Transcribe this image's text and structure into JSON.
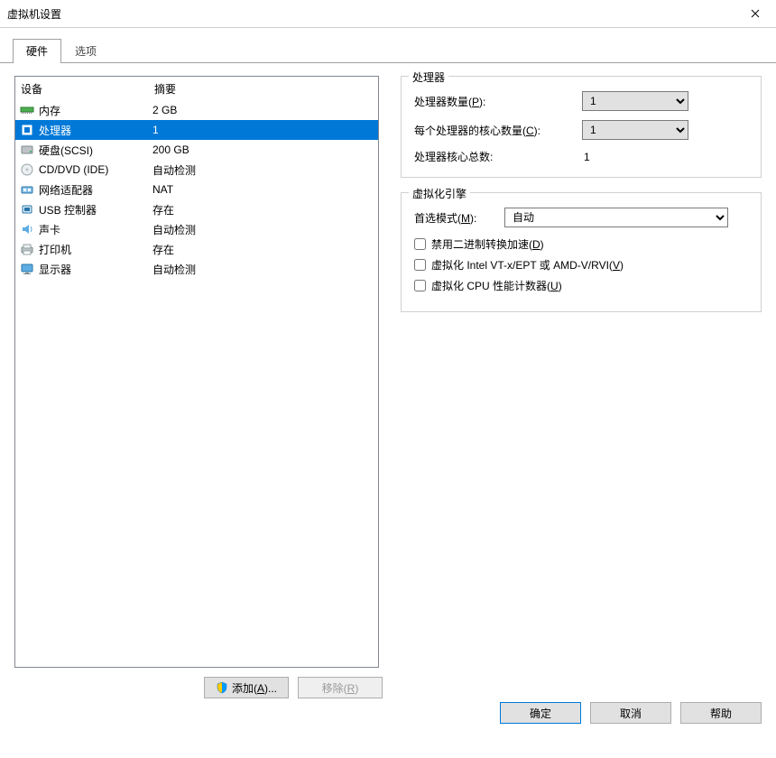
{
  "window": {
    "title": "虚拟机设置"
  },
  "tabs": {
    "hardware": "硬件",
    "options": "选项"
  },
  "hw_header": {
    "device": "设备",
    "summary": "摘要"
  },
  "hw": [
    {
      "icon": "memory",
      "name": "内存",
      "summary": "2 GB"
    },
    {
      "icon": "cpu",
      "name": "处理器",
      "summary": "1"
    },
    {
      "icon": "disk",
      "name": "硬盘(SCSI)",
      "summary": "200 GB"
    },
    {
      "icon": "cd",
      "name": "CD/DVD (IDE)",
      "summary": "自动检测"
    },
    {
      "icon": "net",
      "name": "网络适配器",
      "summary": "NAT"
    },
    {
      "icon": "usb",
      "name": "USB 控制器",
      "summary": "存在"
    },
    {
      "icon": "sound",
      "name": "声卡",
      "summary": "自动检测"
    },
    {
      "icon": "printer",
      "name": "打印机",
      "summary": "存在"
    },
    {
      "icon": "display",
      "name": "显示器",
      "summary": "自动检测"
    }
  ],
  "selected_hw_index": 1,
  "proc_group": {
    "legend": "处理器",
    "proc_count_label_pre": "处理器数量(",
    "proc_count_hot": "P",
    "proc_count_label_post": "):",
    "proc_count_value": "1",
    "cores_label_pre": "每个处理器的核心数量(",
    "cores_hot": "C",
    "cores_label_post": "):",
    "cores_value": "1",
    "total_label": "处理器核心总数:",
    "total_value": "1"
  },
  "virt_group": {
    "legend": "虚拟化引擎",
    "mode_label_pre": "首选模式(",
    "mode_hot": "M",
    "mode_label_post": "):",
    "mode_value": "自动",
    "chk1_pre": "禁用二进制转换加速(",
    "chk1_hot": "D",
    "chk1_post": ")",
    "chk2_pre": "虚拟化 Intel VT-x/EPT 或 AMD-V/RVI(",
    "chk2_hot": "V",
    "chk2_post": ")",
    "chk3_pre": "虚拟化 CPU 性能计数器(",
    "chk3_hot": "U",
    "chk3_post": ")"
  },
  "buttons": {
    "add_pre": "添加(",
    "add_hot": "A",
    "add_post": ")...",
    "remove_pre": "移除(",
    "remove_hot": "R",
    "remove_post": ")",
    "ok": "确定",
    "cancel": "取消",
    "help": "帮助"
  }
}
